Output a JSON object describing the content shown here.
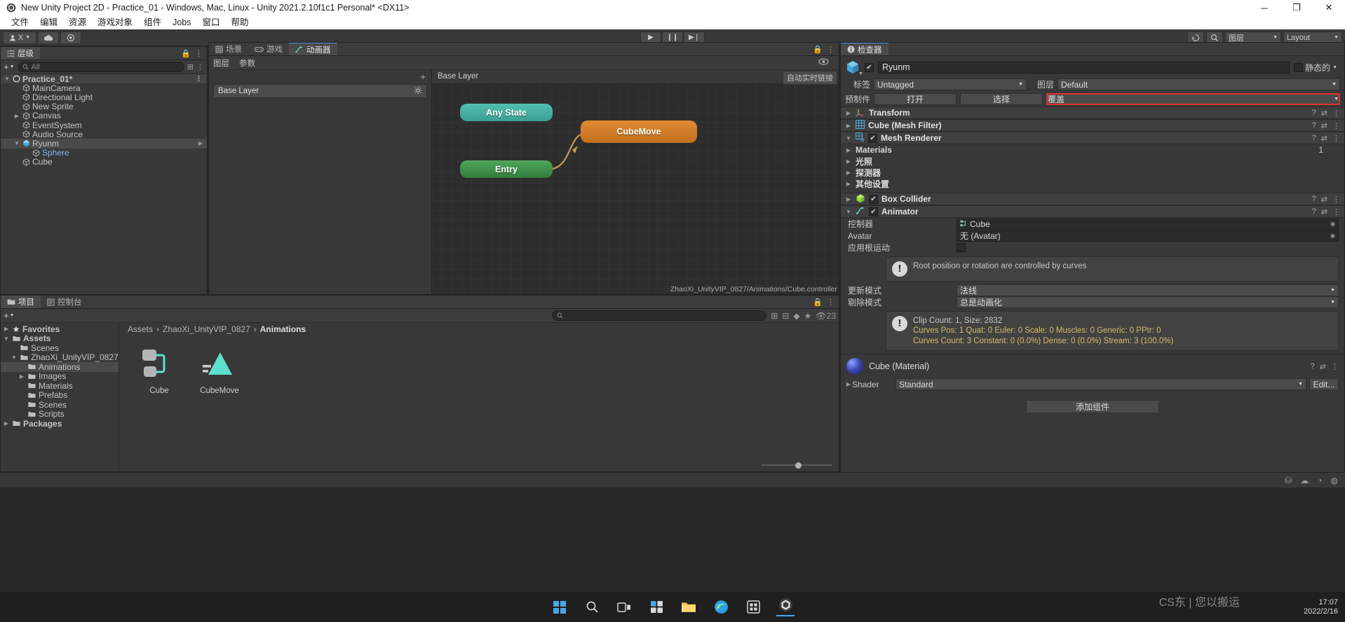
{
  "window": {
    "title": "New Unity Project 2D - Practice_01 - Windows, Mac, Linux - Unity 2021.2.10f1c1 Personal* <DX11>",
    "minimize": "─",
    "maximize": "❐",
    "close": "✕"
  },
  "menu": [
    "文件",
    "编辑",
    "资源",
    "游戏对象",
    "组件",
    "Jobs",
    "窗口",
    "帮助"
  ],
  "toolbar": {
    "account": "X",
    "cloud_icon": "cloud-icon",
    "layers_icon": "layers-icon",
    "play": "▶",
    "pause": "❙❙",
    "step": "▶❘",
    "undo_icon": "history-icon",
    "search_icon": "search-icon",
    "layers_label": "图层",
    "layout_label": "Layout"
  },
  "hierarchy": {
    "tab": "层级",
    "search_placeholder": "All",
    "plus": "+",
    "items": [
      {
        "label": "Practice_01*",
        "depth": 0,
        "arrow": "open",
        "icon": "scene-icon",
        "bold": true,
        "selected": false
      },
      {
        "label": "MainCamera",
        "depth": 1,
        "arrow": "none",
        "icon": "gameobject-icon",
        "bold": false,
        "selected": false
      },
      {
        "label": "Directional Light",
        "depth": 1,
        "arrow": "none",
        "icon": "gameobject-icon",
        "bold": false,
        "selected": false
      },
      {
        "label": "New Sprite",
        "depth": 1,
        "arrow": "none",
        "icon": "gameobject-icon",
        "bold": false,
        "selected": false
      },
      {
        "label": "Canvas",
        "depth": 1,
        "arrow": "closed",
        "icon": "gameobject-icon",
        "bold": false,
        "selected": false
      },
      {
        "label": "EventSystem",
        "depth": 1,
        "arrow": "none",
        "icon": "gameobject-icon",
        "bold": false,
        "selected": false
      },
      {
        "label": "Audio Source",
        "depth": 1,
        "arrow": "none",
        "icon": "gameobject-icon",
        "bold": false,
        "selected": false
      },
      {
        "label": "Ryunm",
        "depth": 1,
        "arrow": "open",
        "icon": "cube-icon",
        "bold": false,
        "selected": true
      },
      {
        "label": "Sphere",
        "depth": 2,
        "arrow": "none",
        "icon": "gameobject-icon",
        "bold": false,
        "selected": false,
        "highlight": true
      },
      {
        "label": "Cube",
        "depth": 1,
        "arrow": "none",
        "icon": "gameobject-icon",
        "bold": false,
        "selected": false
      }
    ]
  },
  "animator": {
    "tabs": [
      {
        "label": "场景",
        "icon": "scene-tab-icon",
        "active": false
      },
      {
        "label": "游戏",
        "icon": "game-tab-icon",
        "active": false
      },
      {
        "label": "动画器",
        "icon": "animator-tab-icon",
        "active": true
      }
    ],
    "subtabs": [
      "图层",
      "参数"
    ],
    "eye_icon": "eye-icon",
    "layer_title": "Base Layer",
    "layer_item": "Base Layer",
    "gear_icon": "gear-icon",
    "plus": "+",
    "auto_live_link": "自动实时链接",
    "graph_path": "ZhaoXi_UnityVIP_0827/Animations/Cube.controller",
    "nodes": [
      {
        "id": "any-state",
        "label": "Any State",
        "color": "#4cbcad"
      },
      {
        "id": "entry",
        "label": "Entry",
        "color": "#3f9a4c"
      },
      {
        "id": "cube-move",
        "label": "CubeMove",
        "color": "#d8812c"
      }
    ]
  },
  "project": {
    "tabs": [
      {
        "label": "项目",
        "active": true
      },
      {
        "label": "控制台",
        "active": false
      }
    ],
    "plus": "+",
    "search_placeholder": "",
    "badge_count": "23",
    "star_icon": "star-icon",
    "tree": [
      {
        "label": "Favorites",
        "depth": 0,
        "arrow": "closed",
        "icon": "star-icon",
        "bold": true,
        "selected": false
      },
      {
        "label": "Assets",
        "depth": 0,
        "arrow": "open",
        "icon": "folder-icon",
        "bold": true,
        "selected": false
      },
      {
        "label": "Scenes",
        "depth": 1,
        "arrow": "none",
        "icon": "folder-icon",
        "bold": false,
        "selected": false
      },
      {
        "label": "ZhaoXi_UnityVIP_0827",
        "depth": 1,
        "arrow": "open",
        "icon": "folder-icon",
        "bold": false,
        "selected": false
      },
      {
        "label": "Animations",
        "depth": 2,
        "arrow": "none",
        "icon": "folder-icon",
        "bold": false,
        "selected": true
      },
      {
        "label": "Images",
        "depth": 2,
        "arrow": "closed",
        "icon": "folder-icon",
        "bold": false,
        "selected": false
      },
      {
        "label": "Materials",
        "depth": 2,
        "arrow": "none",
        "icon": "folder-icon",
        "bold": false,
        "selected": false
      },
      {
        "label": "Prefabs",
        "depth": 2,
        "arrow": "none",
        "icon": "folder-icon",
        "bold": false,
        "selected": false
      },
      {
        "label": "Scenes",
        "depth": 2,
        "arrow": "none",
        "icon": "folder-icon",
        "bold": false,
        "selected": false
      },
      {
        "label": "Scripts",
        "depth": 2,
        "arrow": "none",
        "icon": "folder-icon",
        "bold": false,
        "selected": false
      },
      {
        "label": "Packages",
        "depth": 0,
        "arrow": "closed",
        "icon": "folder-icon",
        "bold": true,
        "selected": false
      }
    ],
    "breadcrumb": [
      "Assets",
      "ZhaoXi_UnityVIP_0827",
      "Animations"
    ],
    "assets": [
      {
        "label": "Cube",
        "type": "animator-controller"
      },
      {
        "label": "CubeMove",
        "type": "animation-clip"
      }
    ]
  },
  "inspector": {
    "tab": "检查器",
    "object_name": "Ryunm",
    "enabled": true,
    "tag_label": "标签",
    "tag_value": "Untagged",
    "layer_label": "图层",
    "layer_value": "Default",
    "prefab_label": "预制件",
    "prefab_open": "打开",
    "prefab_select": "选择",
    "prefab_override": "覆盖",
    "static_label": "静态的",
    "components": [
      {
        "name": "Transform",
        "icon": "transform-icon",
        "expanded": false,
        "has_checkbox": false
      },
      {
        "name": "Cube (Mesh Filter)",
        "icon": "meshfilter-icon",
        "expanded": false,
        "has_checkbox": false
      },
      {
        "name": "Mesh Renderer",
        "icon": "meshrenderer-icon",
        "expanded": true,
        "has_checkbox": true,
        "checked": true
      },
      {
        "name": "Box Collider",
        "icon": "boxcollider-icon",
        "expanded": false,
        "has_checkbox": true,
        "checked": true
      },
      {
        "name": "Animator",
        "icon": "animator-icon",
        "expanded": true,
        "has_checkbox": true,
        "checked": true
      }
    ],
    "mesh_renderer_sections": [
      {
        "label": "Materials",
        "value": "1"
      },
      {
        "label": "光照",
        "value": ""
      },
      {
        "label": "探测器",
        "value": ""
      },
      {
        "label": "其他设置",
        "value": ""
      }
    ],
    "animator_props": [
      {
        "label": "控制器",
        "value": "Cube",
        "type": "object-field",
        "icon": "controller-icon"
      },
      {
        "label": "Avatar",
        "value": "无 (Avatar)",
        "type": "object-field",
        "icon": ""
      },
      {
        "label": "应用根运动",
        "value": "",
        "type": "checkbox",
        "checked": false
      }
    ],
    "animator_warning": "Root position or rotation are controlled by curves",
    "update_mode_label": "更新模式",
    "update_mode_value": "法线",
    "cull_mode_label": "剔除模式",
    "cull_mode_value": "总是动画化",
    "clip_info": [
      "Clip Count: 1, Size: 2832",
      "Curves Pos: 1 Quat: 0 Euler: 0 Scale: 0 Muscles: 0 Generic: 0 PPtr: 0",
      "Curves Count: 3 Constant: 0 (0.0%) Dense: 0 (0.0%) Stream: 3 (100.0%)"
    ],
    "material_name": "Cube (Material)",
    "shader_label": "Shader",
    "shader_value": "Standard",
    "shader_edit": "Edit...",
    "add_component": "添加组件"
  },
  "taskbar": {
    "time": "17:07",
    "date": "2022/2/16",
    "watermark": "CS东  |  您以搬运",
    "icons": [
      "start-icon",
      "search-icon",
      "taskview-icon",
      "widgets-icon",
      "explorer-icon",
      "edge-icon",
      "store-icon",
      "unity-icon"
    ]
  }
}
